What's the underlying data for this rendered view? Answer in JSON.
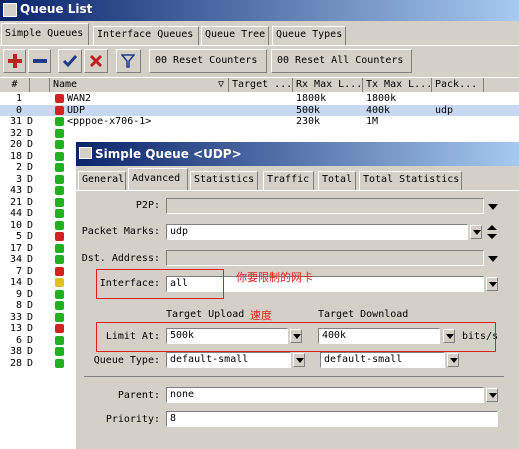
{
  "main_window": {
    "title": "Queue List"
  },
  "tabs": [
    "Simple Queues",
    "Interface Queues",
    "Queue Tree",
    "Queue Types"
  ],
  "toolbar": {
    "reset_counters": "00 Reset Counters",
    "reset_all_counters": "00 Reset All Counters"
  },
  "columns": [
    "#",
    "",
    "Name",
    "Target ...",
    "Rx Max L...",
    "Tx Max L...",
    "Pack..."
  ],
  "rows": [
    {
      "num": "1",
      "flag": "",
      "name": "WAN2",
      "rx": "1800k",
      "tx": "1800k",
      "pack": "",
      "color": "#d42020",
      "selected": false
    },
    {
      "num": "0",
      "flag": "",
      "name": "UDP",
      "rx": "500k",
      "tx": "400k",
      "pack": "udp",
      "color": "#d42020",
      "selected": true
    },
    {
      "num": "31",
      "flag": "D",
      "name": "<pppoe-x706-1>",
      "rx": "230k",
      "tx": "1M",
      "pack": "",
      "color": "#20b020",
      "selected": false
    },
    {
      "num": "32",
      "flag": "D",
      "color": "#20b020"
    },
    {
      "num": "20",
      "flag": "D",
      "color": "#20b020"
    },
    {
      "num": "18",
      "flag": "D",
      "color": "#20b020"
    },
    {
      "num": "2",
      "flag": "D",
      "color": "#20b020"
    },
    {
      "num": "3",
      "flag": "D",
      "color": "#20b020"
    },
    {
      "num": "43",
      "flag": "D",
      "color": "#20b020"
    },
    {
      "num": "21",
      "flag": "D",
      "color": "#20b020"
    },
    {
      "num": "44",
      "flag": "D",
      "color": "#20b020"
    },
    {
      "num": "10",
      "flag": "D",
      "color": "#20b020"
    },
    {
      "num": "5",
      "flag": "D",
      "color": "#d42020"
    },
    {
      "num": "17",
      "flag": "D",
      "color": "#20b020"
    },
    {
      "num": "34",
      "flag": "D",
      "color": "#20b020"
    },
    {
      "num": "7",
      "flag": "D",
      "color": "#d42020"
    },
    {
      "num": "14",
      "flag": "D",
      "color": "#e0c020"
    },
    {
      "num": "9",
      "flag": "D",
      "color": "#20b020"
    },
    {
      "num": "8",
      "flag": "D",
      "color": "#20b020"
    },
    {
      "num": "33",
      "flag": "D",
      "color": "#20b020"
    },
    {
      "num": "13",
      "flag": "D",
      "color": "#d42020"
    },
    {
      "num": "6",
      "flag": "D",
      "color": "#20b020"
    },
    {
      "num": "38",
      "flag": "D",
      "color": "#20b020"
    },
    {
      "num": "28",
      "flag": "D",
      "color": "#20b020"
    }
  ],
  "dialog": {
    "title": "Simple Queue <UDP>",
    "tabs": [
      "General",
      "Advanced",
      "Statistics",
      "Traffic",
      "Total",
      "Total Statistics"
    ],
    "p2p_label": "P2P:",
    "p2p_value": "",
    "packet_marks_label": "Packet Marks:",
    "packet_marks_value": "udp",
    "dst_address_label": "Dst. Address:",
    "dst_address_value": "",
    "interface_label": "Interface:",
    "interface_value": "all",
    "target_upload_label": "Target Upload",
    "target_download_label": "Target Download",
    "limit_at_label": "Limit At:",
    "limit_upload": "500k",
    "limit_download": "400k",
    "unit": "bits/s",
    "queue_type_label": "Queue Type:",
    "queue_type_upload": "default-small",
    "queue_type_download": "default-small",
    "parent_label": "Parent:",
    "parent_value": "none",
    "priority_label": "Priority:",
    "priority_value": "8"
  },
  "annotations": {
    "interface_note": "你要限制的网卡",
    "speed_note": "速度"
  }
}
